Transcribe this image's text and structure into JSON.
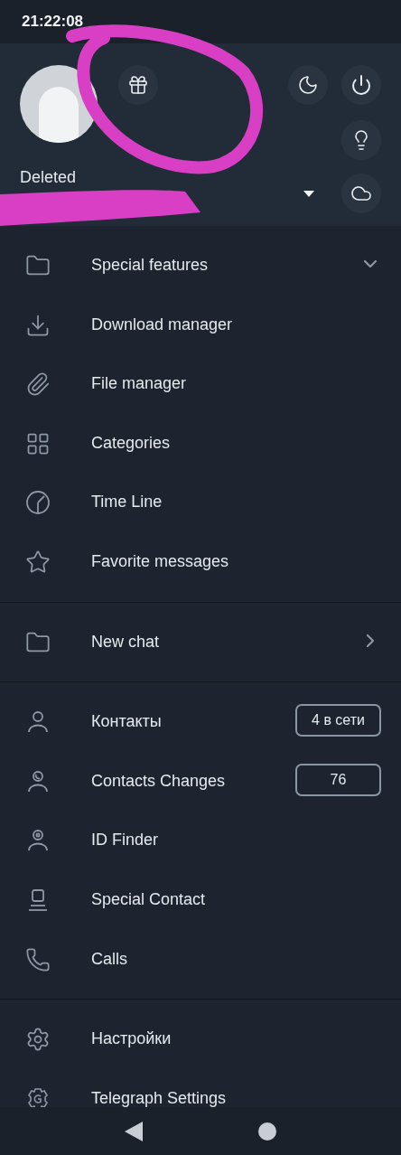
{
  "status_bar": {
    "time": "21:22:08"
  },
  "header": {
    "name": "Deleted",
    "buttons": [
      {
        "kind": "gift"
      },
      {
        "kind": "moon"
      },
      {
        "kind": "power"
      },
      {
        "kind": "bulb"
      },
      {
        "kind": "cloud"
      }
    ]
  },
  "sections": [
    {
      "items": [
        {
          "kind": "folder",
          "label": "Special features",
          "expanded": false
        },
        {
          "kind": "download",
          "label": "Download manager"
        },
        {
          "kind": "paperclip",
          "label": "File manager"
        },
        {
          "kind": "grid",
          "label": "Categories"
        },
        {
          "kind": "clock",
          "label": "Time Line"
        },
        {
          "kind": "star",
          "label": "Favorite messages"
        }
      ]
    },
    {
      "items": [
        {
          "kind": "folder",
          "label": "New chat",
          "submenu": true
        }
      ]
    },
    {
      "items": [
        {
          "kind": "user",
          "label": "Контакты",
          "badge": "4 в сети"
        },
        {
          "kind": "user-radar",
          "label": "Contacts Changes",
          "badge": "76"
        },
        {
          "kind": "user-at",
          "label": "ID Finder"
        },
        {
          "kind": "user-square",
          "label": "Special Contact"
        },
        {
          "kind": "phone",
          "label": "Calls"
        }
      ]
    },
    {
      "items": [
        {
          "kind": "gear",
          "label": "Настройки"
        },
        {
          "kind": "gear-g",
          "label": "Telegraph Settings"
        }
      ]
    }
  ]
}
